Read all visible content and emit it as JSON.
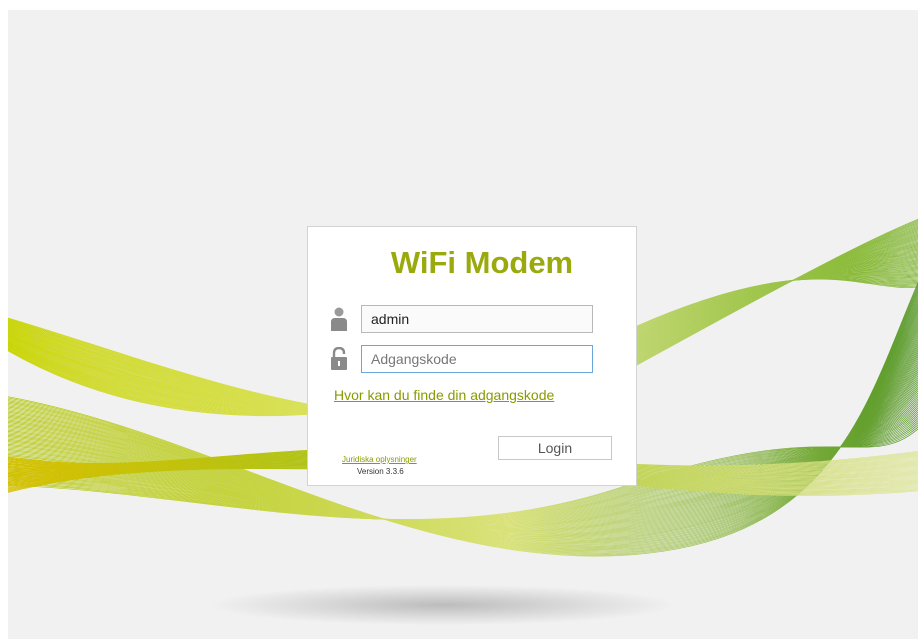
{
  "login": {
    "title": "WiFi Modem",
    "username_value": "admin",
    "password_placeholder": "Adgangskode",
    "help_link": "Hvor kan du finde din adgangskode",
    "login_button": "Login",
    "legal_link": "Juridiska oplysninger",
    "version": "Version 3.3.6"
  },
  "icons": {
    "user": "user-icon",
    "lock": "lock-icon"
  },
  "colors": {
    "brand": "#9aaa0d",
    "link": "#8a9a00",
    "wave_light": "#d7e06a",
    "wave_dark": "#5c9a1e",
    "focus_border": "#6aa8dc"
  }
}
